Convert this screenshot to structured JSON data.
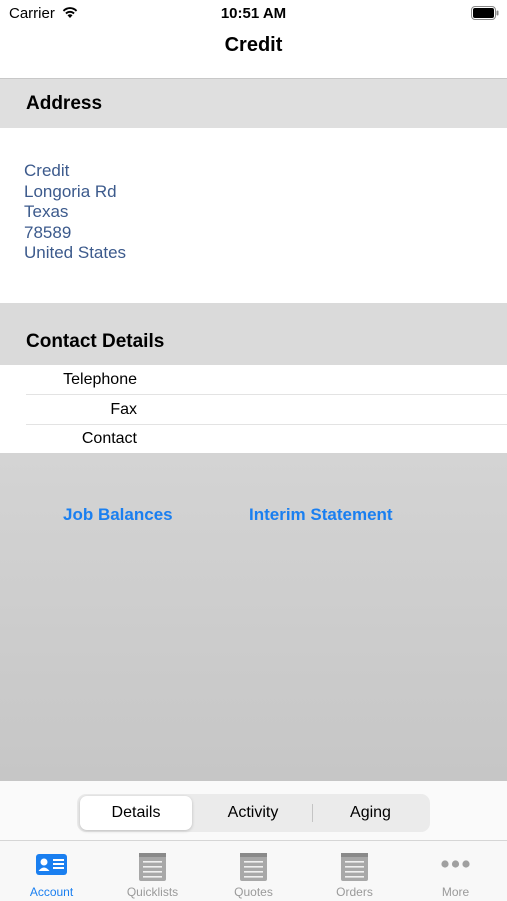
{
  "status_bar": {
    "carrier": "Carrier",
    "time": "10:51 AM"
  },
  "nav": {
    "title": "Credit"
  },
  "address": {
    "header": "Address",
    "lines": [
      "Credit",
      "Longoria Rd",
      "Texas",
      "78589",
      "United States"
    ]
  },
  "contact": {
    "header": "Contact Details",
    "rows": [
      {
        "label": "Telephone"
      },
      {
        "label": "Fax"
      },
      {
        "label": "Contact"
      }
    ]
  },
  "actions": {
    "job_balances": "Job Balances",
    "interim_statement": "Interim Statement"
  },
  "segmented": {
    "items": [
      "Details",
      "Activity",
      "Aging"
    ],
    "selected": "Details"
  },
  "tab_bar": {
    "tabs": [
      {
        "label": "Account",
        "icon": "account-icon",
        "active": true
      },
      {
        "label": "Quicklists",
        "icon": "notepad-icon",
        "active": false
      },
      {
        "label": "Quotes",
        "icon": "notepad-icon",
        "active": false
      },
      {
        "label": "Orders",
        "icon": "notepad-icon",
        "active": false
      },
      {
        "label": "More",
        "icon": "more-icon",
        "active": false
      }
    ]
  },
  "colors": {
    "accent": "#1a7ff0",
    "address_text": "#3c5a8c",
    "inactive_tab": "#9a9a9a"
  }
}
